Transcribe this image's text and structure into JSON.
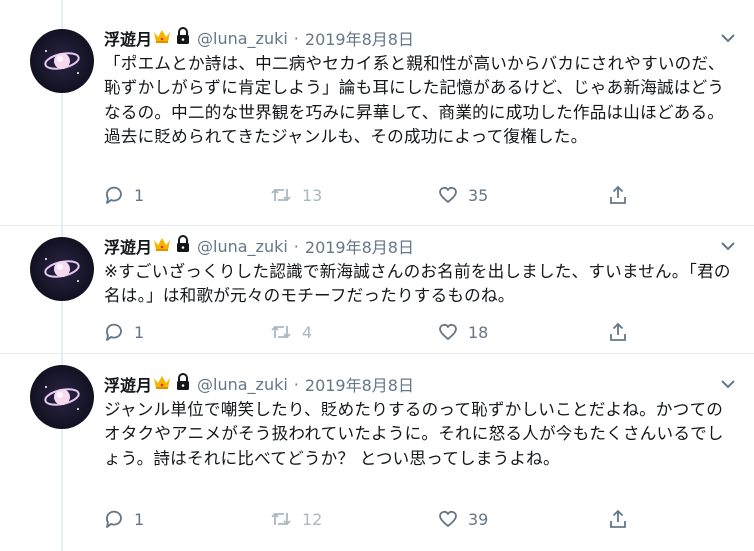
{
  "tweets": [
    {
      "author": "浮遊月",
      "handle": "@luna_zuki",
      "separator": "·",
      "date": "2019年8月8日",
      "text": "「ポエムとか詩は、中二病やセカイ系と親和性が高いからバカにされやすいのだ、恥ずかしがらずに肯定しよう」論も耳にした記憶があるけど、じゃあ新海誠はどうなるの。中二的な世界観を巧みに昇華して、商業的に成功した作品は山ほどある。過去に貶められてきたジャンルも、その成功によって復権した。",
      "replies": "1",
      "retweets": "13",
      "likes": "35"
    },
    {
      "author": "浮遊月",
      "handle": "@luna_zuki",
      "separator": "·",
      "date": "2019年8月8日",
      "text": "※すごいざっくりした認識で新海誠さんのお名前を出しました、すいません。「君の名は。」は和歌が元々のモチーフだったりするものね。",
      "replies": "1",
      "retweets": "4",
      "likes": "18"
    },
    {
      "author": "浮遊月",
      "handle": "@luna_zuki",
      "separator": "·",
      "date": "2019年8月8日",
      "text": "ジャンル単位で嘲笑したり、貶めたりするのって恥ずかしいことだよね。かつてのオタクやアニメがそう扱われていたように。それに怒る人が今もたくさんいるでしょう。詩はそれに比べてどうか？ とつい思ってしまうよね。",
      "replies": "1",
      "retweets": "12",
      "likes": "39"
    }
  ],
  "icons": {
    "badge": "crown-icon",
    "protected": "lock-icon",
    "menu": "chevron-down-icon",
    "reply": "reply-icon",
    "retweet": "retweet-icon",
    "like": "heart-icon",
    "share": "share-icon"
  },
  "colors": {
    "text": "#14171a",
    "secondary": "#657786",
    "disabled": "#aab8c2",
    "divider": "#e6ecf0",
    "crown": "#f4b400"
  }
}
